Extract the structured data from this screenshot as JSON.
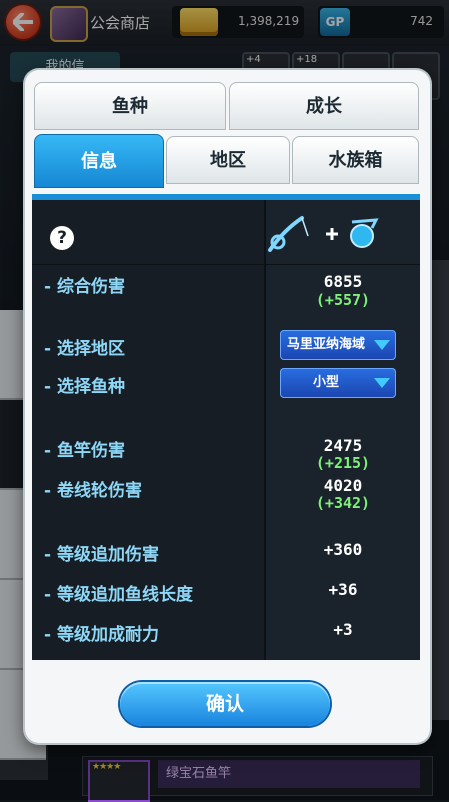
{
  "header": {
    "title": "公会商店",
    "gold": "1,398,219",
    "gp_label": "GP",
    "gp_value": "742"
  },
  "background": {
    "my_info_tab": "我的信",
    "slot_counts": [
      "+4",
      "+18"
    ],
    "bottom_item_name": "绿宝石鱼竿",
    "bottom_item_stars": "★★★★"
  },
  "modal": {
    "tabs_top": [
      "鱼种",
      "成长"
    ],
    "tabs_bottom": [
      "信息",
      "地区",
      "水族箱"
    ],
    "active_tab": "信息",
    "help": "?",
    "rows": {
      "total_damage": {
        "label": "- 综合伤害",
        "value": "6855",
        "bonus": "(+557)"
      },
      "select_region": {
        "label": "- 选择地区",
        "selected": "马里亚纳海域"
      },
      "select_fish": {
        "label": "- 选择鱼种",
        "selected": "小型"
      },
      "rod_damage": {
        "label": "- 鱼竿伤害",
        "value": "2475",
        "bonus": "(+215)"
      },
      "reel_damage": {
        "label": "- 卷线轮伤害",
        "value": "4020",
        "bonus": "(+342)"
      },
      "level_damage": {
        "label": "- 等级追加伤害",
        "value": "+360"
      },
      "level_line": {
        "label": "- 等级追加鱼线长度",
        "value": "+36"
      },
      "level_durability": {
        "label": "- 等级加成耐力",
        "value": "+3"
      }
    },
    "confirm_label": "确认"
  },
  "colors": {
    "accent": "#1b8ed8",
    "label": "#8ed7f6",
    "bonus": "#7ff07a",
    "dropdown": "#1a45b0"
  }
}
